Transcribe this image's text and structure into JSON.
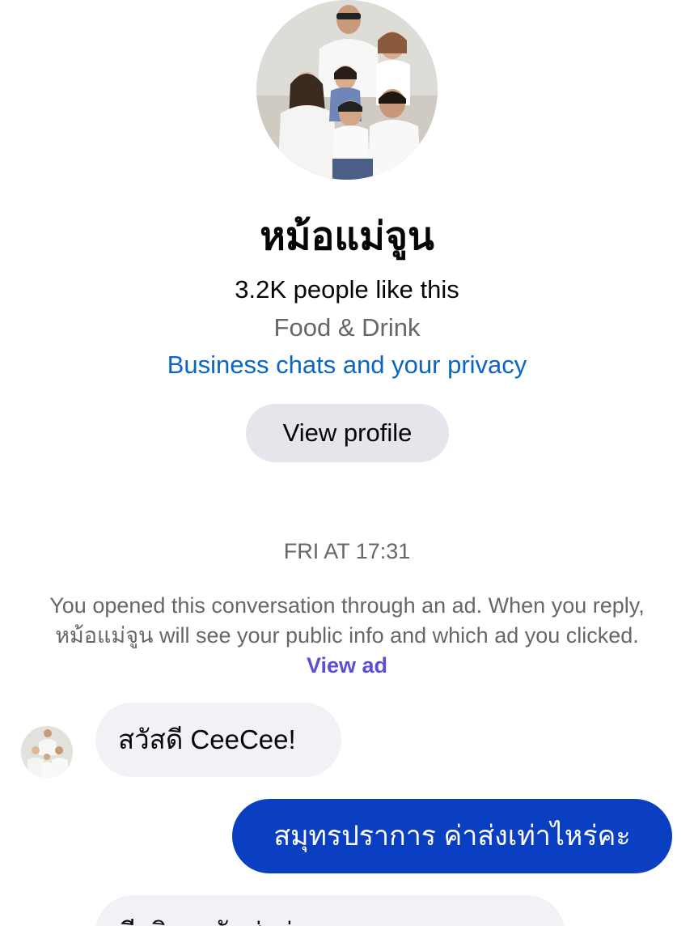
{
  "profile": {
    "name": "หม้อแม่จูน",
    "likes": "3.2K people like this",
    "category": "Food & Drink",
    "privacy_link": "Business chats and your privacy",
    "view_profile_label": "View profile",
    "avatar_icon": "family-photo-avatar"
  },
  "conversation": {
    "timestamp": "FRI AT 17:31",
    "ad_notice": "You opened this conversation through an ad. When you reply, หม้อแม่จูน will see your public info and which ad you clicked.",
    "view_ad_label": "View ad",
    "messages": [
      {
        "direction": "incoming",
        "text": "สวัสดี CeeCee!"
      },
      {
        "direction": "outgoing",
        "text": "สมุทรปราการ ค่าส่งเท่าไหร่คะ"
      },
      {
        "direction": "incoming",
        "text": "มีบริการจัดส่งค่ะ"
      }
    ]
  },
  "colors": {
    "link_blue": "#0a66c2",
    "outgoing_bubble": "#0a3fc2",
    "incoming_bubble": "#f0f2f5",
    "view_ad_purple": "#5b4fd6",
    "secondary_text": "#65676b"
  }
}
